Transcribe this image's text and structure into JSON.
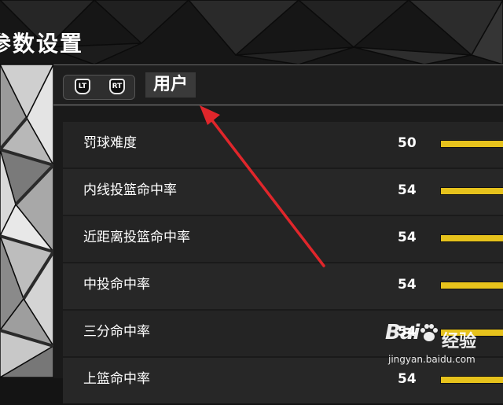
{
  "page": {
    "title": "参数设置"
  },
  "tab_bar": {
    "lt_label": "LT",
    "rt_label": "RT",
    "active_tab": "用户"
  },
  "settings": [
    {
      "label": "罚球难度",
      "value": "50",
      "level": 50
    },
    {
      "label": "内线投篮命中率",
      "value": "54",
      "level": 54
    },
    {
      "label": "近距离投篮命中率",
      "value": "54",
      "level": 54
    },
    {
      "label": "中投命中率",
      "value": "54",
      "level": 54
    },
    {
      "label": "三分命中率",
      "value": "54",
      "level": 54
    },
    {
      "label": "上篮命中率",
      "value": "54",
      "level": 54
    }
  ],
  "colors": {
    "bar": "#e6c21c",
    "annotation_arrow": "#e0262b"
  },
  "watermark": {
    "logo": "Bai",
    "brand": "经验",
    "url": "jingyan.baidu.com"
  }
}
